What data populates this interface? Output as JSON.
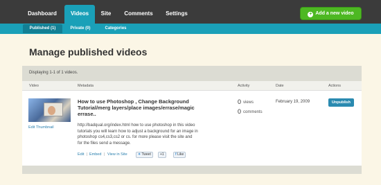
{
  "nav": {
    "tabs": [
      {
        "label": "Dashboard"
      },
      {
        "label": "Videos"
      },
      {
        "label": "Site"
      },
      {
        "label": "Comments"
      },
      {
        "label": "Settings"
      }
    ],
    "active_tab": "Videos",
    "add_button": "Add a new video"
  },
  "subnav": {
    "tabs": [
      {
        "label": "Published (1)"
      },
      {
        "label": "Private (0)"
      },
      {
        "label": "Categories"
      }
    ],
    "active_tab": "Published (1)"
  },
  "page_title": "Manage published videos",
  "summary": "Displaying 1-1 of 1 videos.",
  "columns": [
    "Video",
    "Metadata",
    "Activity",
    "Date",
    "Actions"
  ],
  "video": {
    "edit_thumbnail": "Edit Thumbnail",
    "title_lines": [
      "How to use Photoshop , Change Background",
      "Tutorial/merg layers/place images/errase/magic",
      "errase.."
    ],
    "description_lines": [
      "http://badqual.org/index.html how to use photoshop in this video",
      "tutorials you will learn how to adjust a background for an image in",
      "photoshop cs4,cs3,cs2 or cs. for more please visit the site and",
      "for the files send a message."
    ],
    "links": {
      "edit": "Edit",
      "embed": "Embed",
      "view_in_site": "View in Site",
      "tweet": "Tweet",
      "plus_one": "+1",
      "like": "Like"
    },
    "views_count": "0",
    "views_label": "views",
    "comments_count": "0",
    "comments_label": "comments",
    "date": "February 19, 2009",
    "action": "Unpublish"
  },
  "colors": {
    "topbar": "#3b3b3b",
    "accent": "#1aa0b8",
    "add_button": "#4db822",
    "background": "#fbf6e6"
  }
}
